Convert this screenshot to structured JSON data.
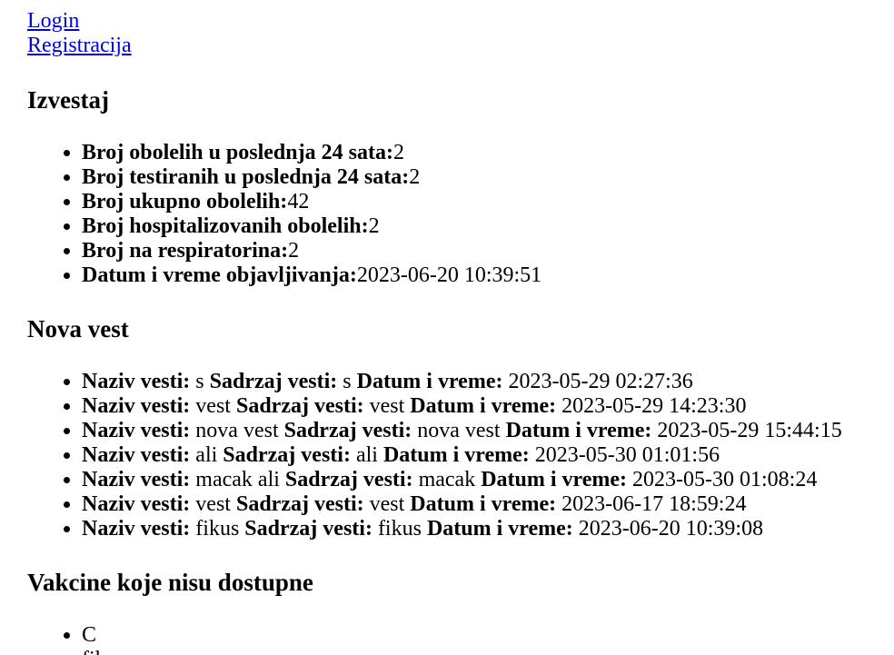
{
  "nav": {
    "login": "Login",
    "register": "Registracija"
  },
  "report": {
    "title": "Izvestaj",
    "items": [
      {
        "label": "Broj obolelih u poslednja 24 sata:",
        "value": "2"
      },
      {
        "label": "Broj testiranih u poslednja 24 sata:",
        "value": "2"
      },
      {
        "label": "Broj ukupno obolelih:",
        "value": "42"
      },
      {
        "label": "Broj hospitalizovanih obolelih:",
        "value": "2"
      },
      {
        "label": "Broj na respiratorina:",
        "value": "2"
      },
      {
        "label": "Datum i vreme objavljivanja:",
        "value": "2023-06-20 10:39:51"
      }
    ]
  },
  "news": {
    "title": "Nova vest",
    "name_label": "Naziv vesti:",
    "content_label": "Sadrzaj vesti:",
    "date_label": "Datum i vreme:",
    "items": [
      {
        "name": "s",
        "content": "s",
        "date": "2023-05-29 02:27:36"
      },
      {
        "name": "vest",
        "content": "vest",
        "date": "2023-05-29 14:23:30"
      },
      {
        "name": "nova vest",
        "content": "nova vest",
        "date": "2023-05-29 15:44:15"
      },
      {
        "name": "ali",
        "content": "ali",
        "date": "2023-05-30 01:01:56"
      },
      {
        "name": "macak ali",
        "content": "macak",
        "date": "2023-05-30 01:08:24"
      },
      {
        "name": "vest",
        "content": "vest",
        "date": "2023-06-17 18:59:24"
      },
      {
        "name": "fikus",
        "content": "fikus",
        "date": "2023-06-20 10:39:08"
      }
    ]
  },
  "vaccines": {
    "title": "Vakcine koje nisu dostupne",
    "items": [
      "C",
      "fikus"
    ]
  }
}
